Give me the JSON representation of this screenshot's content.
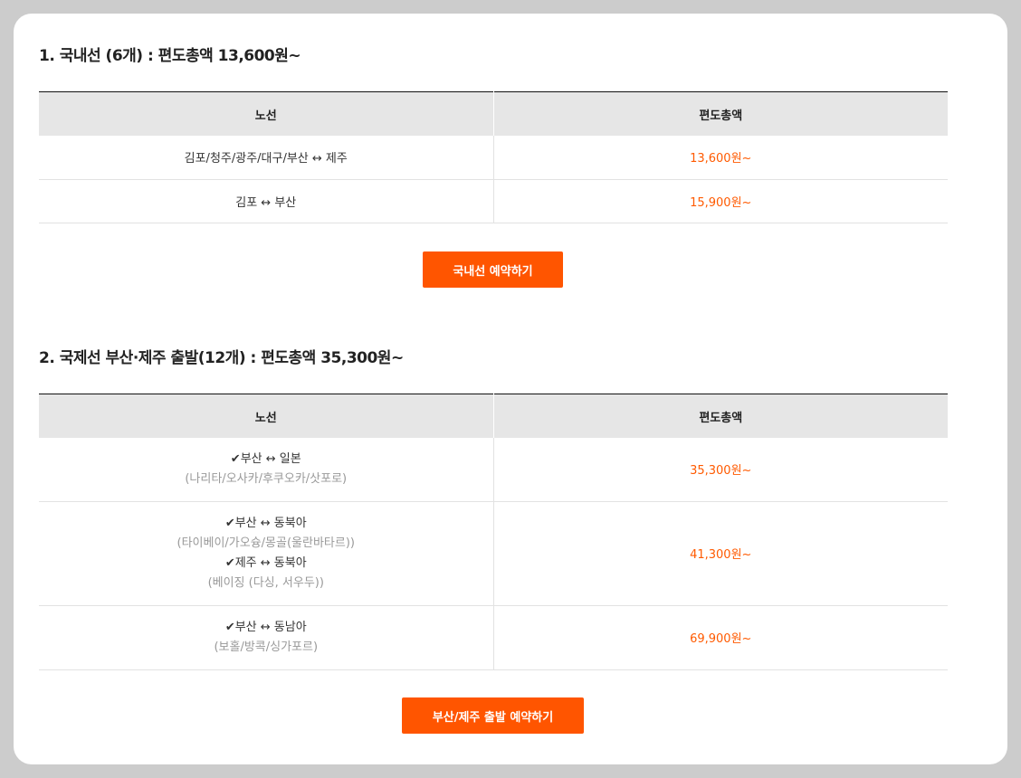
{
  "colors": {
    "accent": "#ff5500",
    "price": "#ff5a00",
    "header_bg": "#e6e6e6"
  },
  "domestic": {
    "title": "1. 국내선 (6개) : 편도총액 13,600원~",
    "headers": {
      "route": "노선",
      "fare": "편도총액"
    },
    "rows": [
      {
        "route": "김포/청주/광주/대구/부산 ↔ 제주",
        "price": "13,600원~"
      },
      {
        "route": "김포 ↔ 부산",
        "price": "15,900원~"
      }
    ],
    "button": "국내선 예약하기"
  },
  "international": {
    "title": "2. 국제선 부산·제주 출발(12개) : 편도총액 35,300원~",
    "headers": {
      "route": "노선",
      "fare": "편도총액"
    },
    "rows": [
      {
        "lines": [
          {
            "check": "✔",
            "text": "부산 ↔ 일본"
          },
          {
            "sub": "(나리타/오사카/후쿠오카/삿포로)"
          }
        ],
        "price": "35,300원~"
      },
      {
        "lines": [
          {
            "check": "✔",
            "text": "부산 ↔ 동북아"
          },
          {
            "sub": "(타이베이/가오슝/몽골(울란바타르))"
          },
          {
            "check": "✔",
            "text": "제주 ↔ 동북아"
          },
          {
            "sub": "(베이징 (다싱, 서우두))"
          }
        ],
        "price": "41,300원~"
      },
      {
        "lines": [
          {
            "check": "✔",
            "text": "부산 ↔ 동남아"
          },
          {
            "sub": "(보홀/방콕/싱가포르)"
          }
        ],
        "price": "69,900원~"
      }
    ],
    "button": "부산/제주 출발 예약하기"
  }
}
